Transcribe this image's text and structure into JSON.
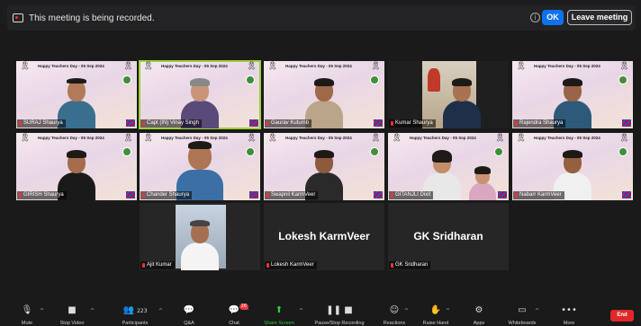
{
  "banner": {
    "recording_text": "This meeting is being recorded.",
    "ok_label": "OK",
    "leave_label": "Leave meeting"
  },
  "background": {
    "title": "Happy Teachers Day - 05 Sep 2024",
    "subtitle": "Bengaluru Sushila Ideas Collectivepurple"
  },
  "participants": [
    {
      "name": "SURAJ Shaurya"
    },
    {
      "name": "Capt (IN) Vinay Singh"
    },
    {
      "name": "Gaurav Kutumb"
    },
    {
      "name": "Kumar Shaurya"
    },
    {
      "name": "Rajendra Shaurya"
    },
    {
      "name": "GIRISH Shaurya"
    },
    {
      "name": "Chander Shaurya"
    },
    {
      "name": "Swapnil KarmVeer"
    },
    {
      "name": "GITANJLI Dixit"
    },
    {
      "name": "Nabarr KarmVeer"
    },
    {
      "name": "Ajit Kumar"
    },
    {
      "name": "Lokesh KarmVeer",
      "display": "Lokesh KarmVeer"
    },
    {
      "name": "GK Sridharan",
      "display": "GK Sridharan"
    }
  ],
  "toolbar": {
    "mute": "Mute",
    "stop_video": "Stop Video",
    "participants": "Participants",
    "participants_count": "223",
    "qa": "Q&A",
    "chat": "Chat",
    "chat_badge": "26",
    "share_screen": "Share Screen",
    "pause_recording": "Pause/Stop Recording",
    "reactions": "Reactions",
    "raise_hand": "Raise Hand",
    "apps": "Apps",
    "whiteboards": "Whiteboards",
    "more": "More",
    "end": "End"
  },
  "colors": {
    "accent": "#0e72ed",
    "share_green": "#2fcc3c",
    "end_red": "#e02828",
    "highlight": "#9ad03a"
  }
}
